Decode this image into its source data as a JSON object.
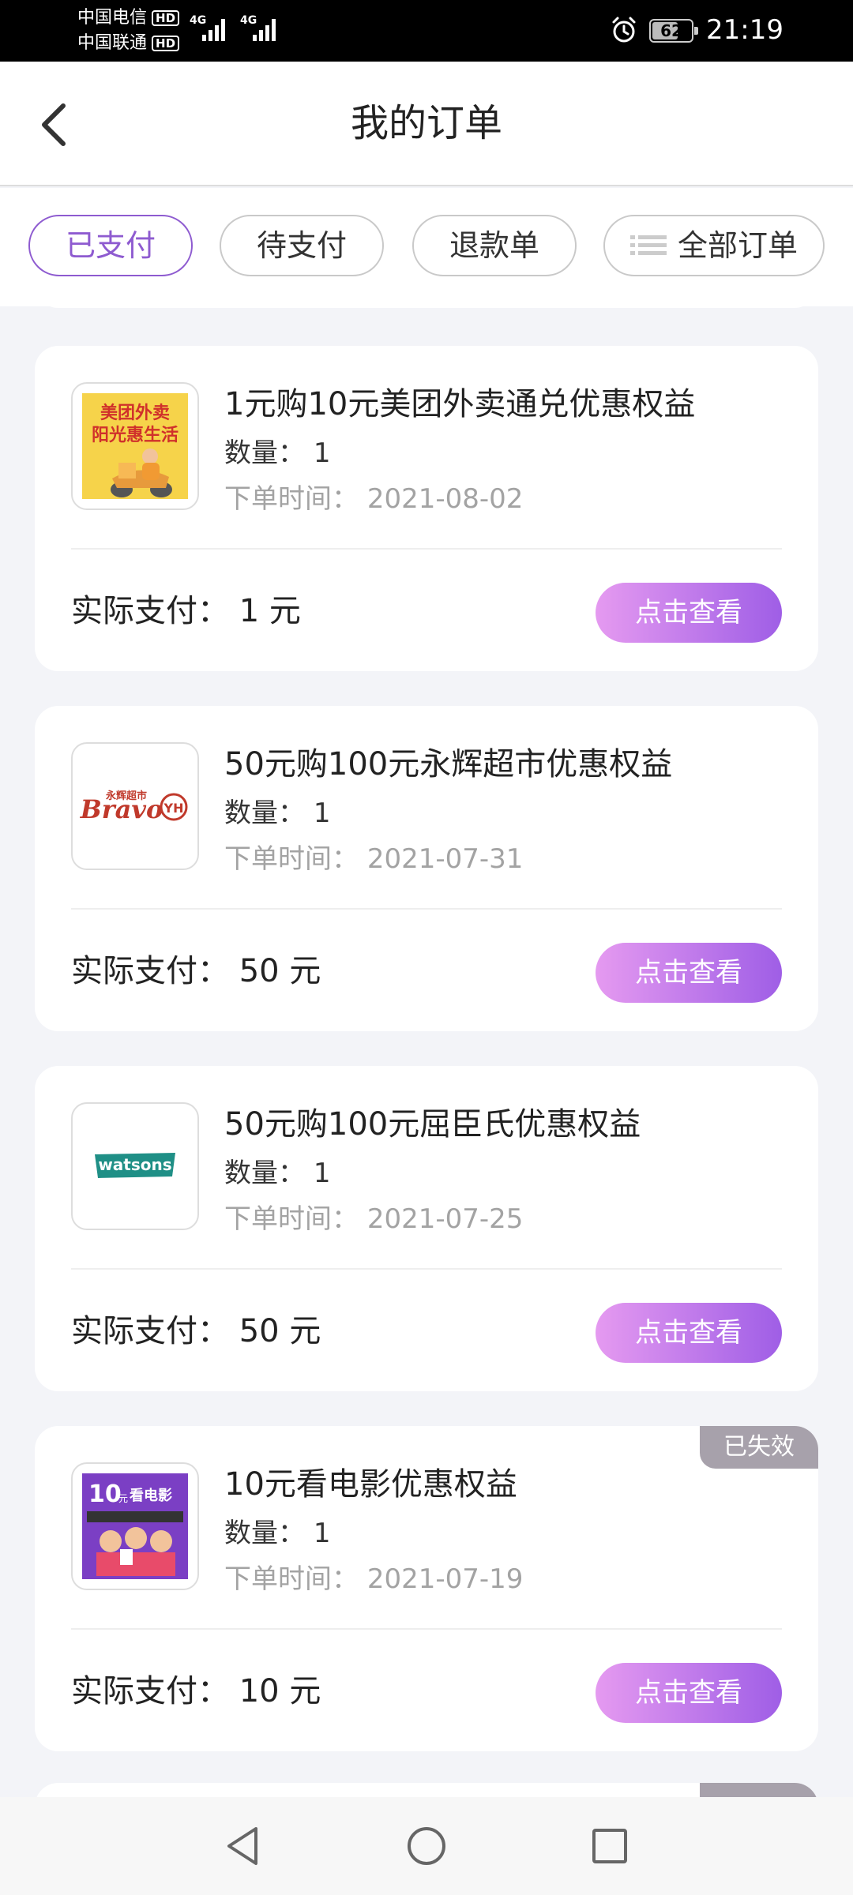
{
  "status_bar": {
    "carrier1": "中国电信",
    "carrier2": "中国联通",
    "hd": "HD",
    "network1": "4G",
    "network2": "4G",
    "battery": "62",
    "time": "21:19"
  },
  "header": {
    "title": "我的订单"
  },
  "tabs": [
    {
      "label": "已支付",
      "active": true
    },
    {
      "label": "待支付",
      "active": false
    },
    {
      "label": "退款单",
      "active": false
    },
    {
      "label": "全部订单",
      "active": false
    }
  ],
  "labels": {
    "quantity_prefix": "数量：",
    "order_time_prefix": "下单时间：",
    "paid_prefix": "实际支付：",
    "view_button": "点击查看",
    "expired_badge": "已失效",
    "currency": "元"
  },
  "orders": [
    {
      "title": "1元购10元美团外卖通兑优惠权益",
      "quantity": "1",
      "order_date": "2021-08-02",
      "amount": "1",
      "thumb_text_1": "美团外卖",
      "thumb_text_2": "阳光惠生活",
      "expired": false
    },
    {
      "title": "50元购100元永辉超市优惠权益",
      "quantity": "1",
      "order_date": "2021-07-31",
      "amount": "50",
      "thumb_text_1": "永辉超市",
      "thumb_text_2": "Bravo",
      "thumb_text_3": "YH",
      "expired": false
    },
    {
      "title": "50元购100元屈臣氏优惠权益",
      "quantity": "1",
      "order_date": "2021-07-25",
      "amount": "50",
      "thumb_text_1": "watsons",
      "expired": false
    },
    {
      "title": "10元看电影优惠权益",
      "quantity": "1",
      "order_date": "2021-07-19",
      "amount": "10",
      "thumb_text_1": "10",
      "thumb_text_2": "元",
      "thumb_text_3": "看电影",
      "expired": true
    }
  ],
  "colors": {
    "accent": "#8e5bd0",
    "button_gradient_start": "#e59af0",
    "button_gradient_end": "#9f5ee6",
    "expired_badge": "#a7a1ab",
    "page_bg": "#f3f4f8"
  }
}
